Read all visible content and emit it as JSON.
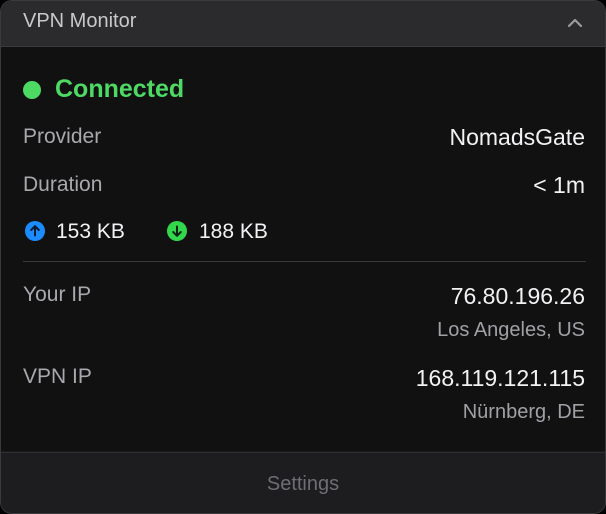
{
  "header": {
    "title": "VPN Monitor"
  },
  "status": {
    "text": "Connected",
    "color": "#4cd964"
  },
  "provider": {
    "label": "Provider",
    "value": "NomadsGate"
  },
  "duration": {
    "label": "Duration",
    "value": "< 1m"
  },
  "traffic": {
    "upload": "153 KB",
    "download": "188 KB",
    "upload_color": "#1a8cff",
    "download_color": "#32d74b"
  },
  "your_ip": {
    "label": "Your IP",
    "value": "76.80.196.26",
    "location": "Los Angeles, US"
  },
  "vpn_ip": {
    "label": "VPN IP",
    "value": "168.119.121.115",
    "location": "Nürnberg, DE"
  },
  "footer": {
    "settings_label": "Settings"
  },
  "icons": {
    "collapse": "chevron-up-icon",
    "upload": "arrow-up-circle-icon",
    "download": "arrow-down-circle-icon"
  }
}
